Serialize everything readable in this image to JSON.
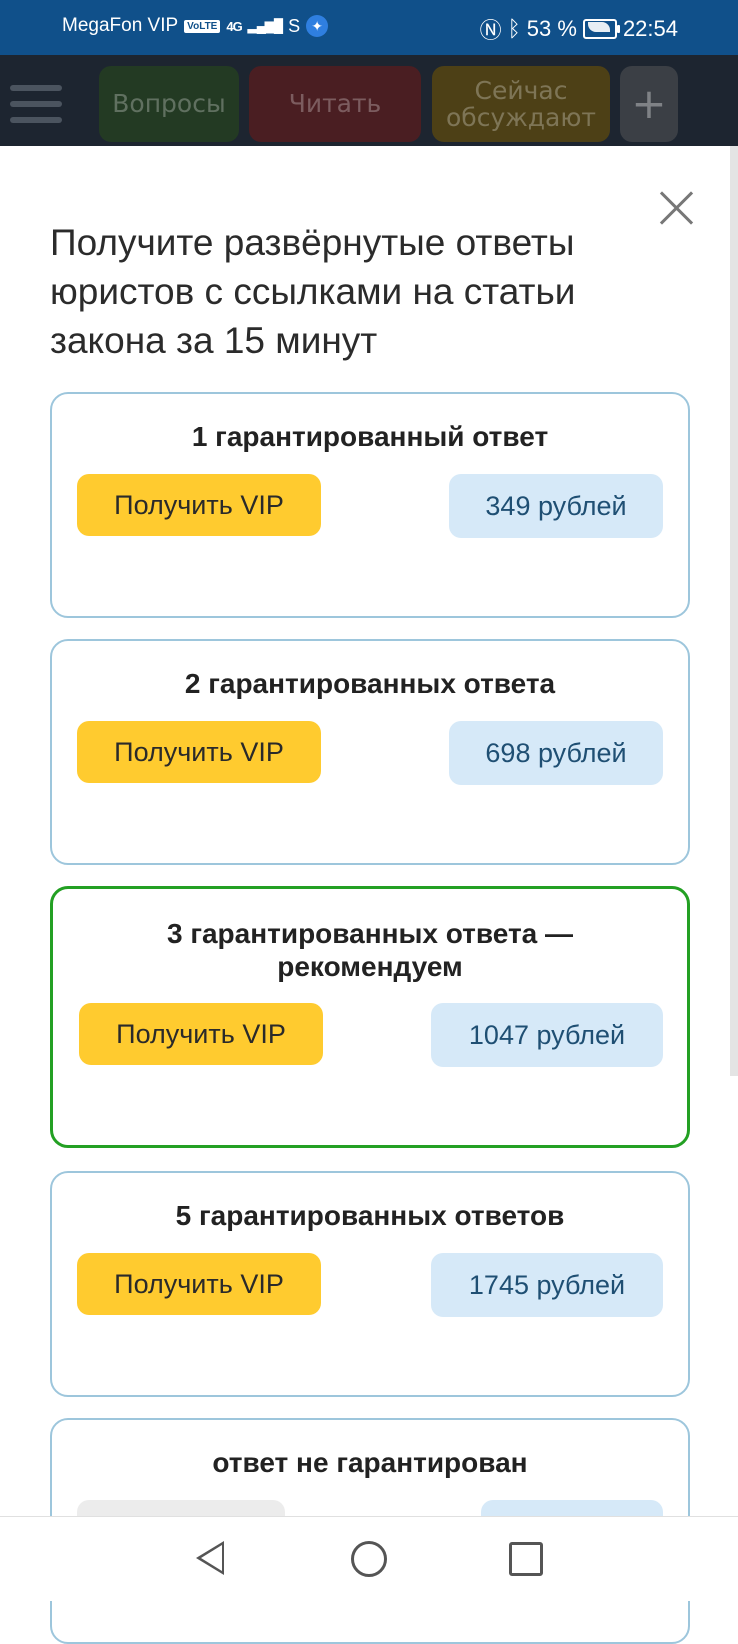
{
  "status_bar": {
    "carrier": "MegaFon VIP",
    "volte": "VoLTE",
    "network": "4G",
    "battery_percent": "53 %",
    "time": "22:54",
    "accent_color": "#10508a"
  },
  "app_bar": {
    "tabs": [
      {
        "label": "Вопросы",
        "color": "#2c7a2c"
      },
      {
        "label": "Читать",
        "color": "#c2303c"
      },
      {
        "label": "Сейчас обсуждают",
        "color": "#d6a81a"
      }
    ],
    "add_label": "+"
  },
  "sheet": {
    "heading": "Получите развёрнутые ответы юристов с ссылками на статьи закона за 15 минут",
    "offers": [
      {
        "title": "1 гарантированный ответ",
        "button": "Получить VIP",
        "price": "349 рублей",
        "recommended": false
      },
      {
        "title": "2 гарантированных ответа",
        "button": "Получить VIP",
        "price": "698 рублей",
        "recommended": false
      },
      {
        "title": "3 гарантированных ответа — рекомендуем",
        "button": "Получить VIP",
        "price": "1047 рублей",
        "recommended": true
      },
      {
        "title": "5 гарантированных ответов",
        "button": "Получить VIP",
        "price": "1745 рублей",
        "recommended": false
      },
      {
        "title": "ответ не гарантирован",
        "button": "",
        "price": "",
        "recommended": false
      }
    ]
  },
  "colors": {
    "vip_button": "#ffcb2f",
    "price_badge": "#d6e9f8",
    "card_border": "#9dc6dc",
    "recommended_border": "#23a023"
  }
}
